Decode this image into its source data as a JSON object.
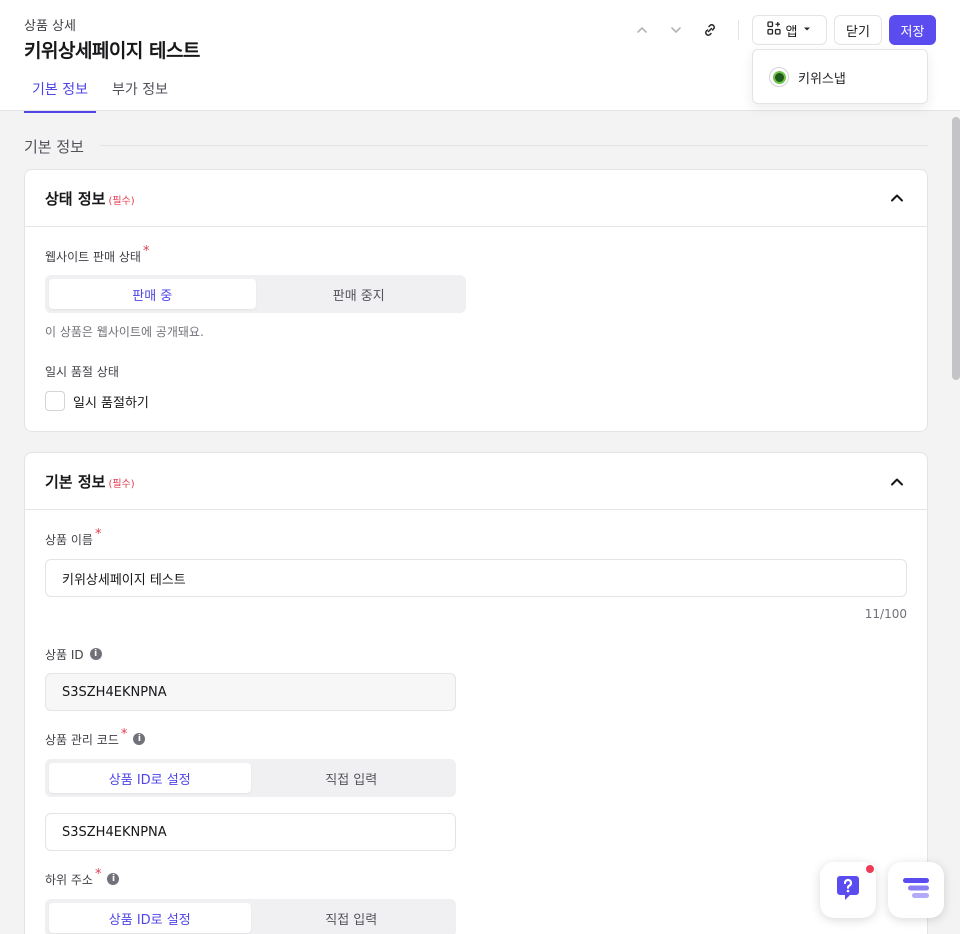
{
  "header": {
    "breadcrumb": "상품 상세",
    "title": "키위상세페이지 테스트",
    "tabs": [
      {
        "label": "기본 정보",
        "active": true
      },
      {
        "label": "부가 정보",
        "active": false
      }
    ],
    "apps_label": "앱",
    "close_label": "닫기",
    "save_label": "저장",
    "accent_color": "#5b4cf0"
  },
  "apps_dropdown": {
    "items": [
      {
        "label": "키위스냅",
        "icon": "kiwisnap-logo"
      }
    ]
  },
  "section_heading": "기본 정보",
  "status_card": {
    "title": "상태 정보",
    "required_tag": "(필수)",
    "sale_status": {
      "label": "웹사이트 판매 상태",
      "options": [
        "판매 중",
        "판매 중지"
      ],
      "selected": "판매 중",
      "help": "이 상품은 웹사이트에 공개돼요."
    },
    "soldout": {
      "label": "일시 품절 상태",
      "checkbox_label": "일시 품절하기",
      "checked": false
    }
  },
  "basic_card": {
    "title": "기본 정보",
    "required_tag": "(필수)",
    "product_name": {
      "label": "상품 이름",
      "value": "키위상세페이지 테스트",
      "counter": "11/100"
    },
    "product_id": {
      "label": "상품 ID",
      "value": "S3SZH4EKNPNA"
    },
    "management_code": {
      "label": "상품 관리 코드",
      "options": [
        "상품 ID로 설정",
        "직접 입력"
      ],
      "selected": "상품 ID로 설정",
      "value": "S3SZH4EKNPNA"
    },
    "sub_address": {
      "label": "하위 주소",
      "options": [
        "상품 ID로 설정",
        "직접 입력"
      ],
      "selected": "상품 ID로 설정"
    }
  }
}
